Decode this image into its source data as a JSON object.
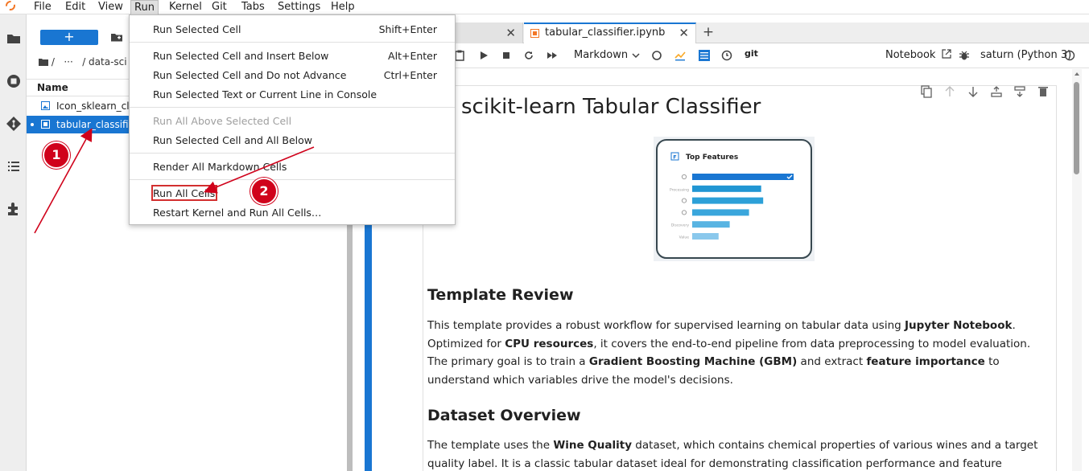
{
  "menubar": {
    "items": [
      "File",
      "Edit",
      "View",
      "Run",
      "Kernel",
      "Git",
      "Tabs",
      "Settings",
      "Help"
    ]
  },
  "filebrowser": {
    "new_label": "+",
    "breadcrumb": "/   ···   / data-sci",
    "name_header": "Name",
    "files": [
      {
        "name": "Icon_sklearn_cl"
      },
      {
        "name": "tabular_classifie"
      }
    ]
  },
  "tabs": [
    {
      "label": ""
    },
    {
      "label": "tabular_classifier.ipynb"
    }
  ],
  "toolbar": {
    "cell_type": "Markdown",
    "git_label": "git",
    "notebook_label": "Notebook",
    "kernel_label": "saturn (Python 3)"
  },
  "run_menu": {
    "items": [
      {
        "label": "Run Selected Cell",
        "shortcut": "Shift+Enter"
      },
      {
        "label": "Run Selected Cell and Insert Below",
        "shortcut": "Alt+Enter"
      },
      {
        "label": "Run Selected Cell and Do not Advance",
        "shortcut": "Ctrl+Enter"
      },
      {
        "label": "Run Selected Text or Current Line in Console",
        "shortcut": ""
      },
      {
        "label": "Run All Above Selected Cell",
        "shortcut": ""
      },
      {
        "label": "Run Selected Cell and All Below",
        "shortcut": ""
      },
      {
        "label": "Render All Markdown Cells",
        "shortcut": ""
      },
      {
        "label": "Run All Cells",
        "shortcut": ""
      },
      {
        "label": "Restart Kernel and Run All Cells…",
        "shortcut": ""
      }
    ]
  },
  "notebook": {
    "title": "scikit-learn Tabular Classifier",
    "image": {
      "heading": "Top Features",
      "row_labels": [
        "",
        "Processing",
        "",
        "",
        "Discovery",
        "Value"
      ],
      "bar_values": [
        1.0,
        0.68,
        0.7,
        0.56,
        0.37,
        0.26
      ]
    },
    "section1": {
      "heading": "Template Review",
      "p1a": "This template provides a robust workflow for supervised learning on tabular data using ",
      "p1b": "Jupyter Notebook",
      "p1c": ". Optimized for ",
      "p1d": "CPU resources",
      "p1e": ", it covers the end-to-end pipeline from data preprocessing to model evaluation. The primary goal is to train a ",
      "p1f": "Gradient Boosting Machine (GBM)",
      "p1g": " and extract ",
      "p1h": "feature importance",
      "p1i": " to understand which variables drive the model's decisions."
    },
    "section2": {
      "heading": "Dataset Overview",
      "p2a": "The template uses the ",
      "p2b": "Wine Quality",
      "p2c": " dataset, which contains chemical properties of various wines and a target quality label. It is a classic tabular dataset ideal for demonstrating classification performance and feature ranking."
    }
  },
  "annotations": {
    "badge1": "1",
    "badge2": "2"
  },
  "colors": {
    "accent": "#1976d2",
    "annotation_red": "#d0021b"
  }
}
